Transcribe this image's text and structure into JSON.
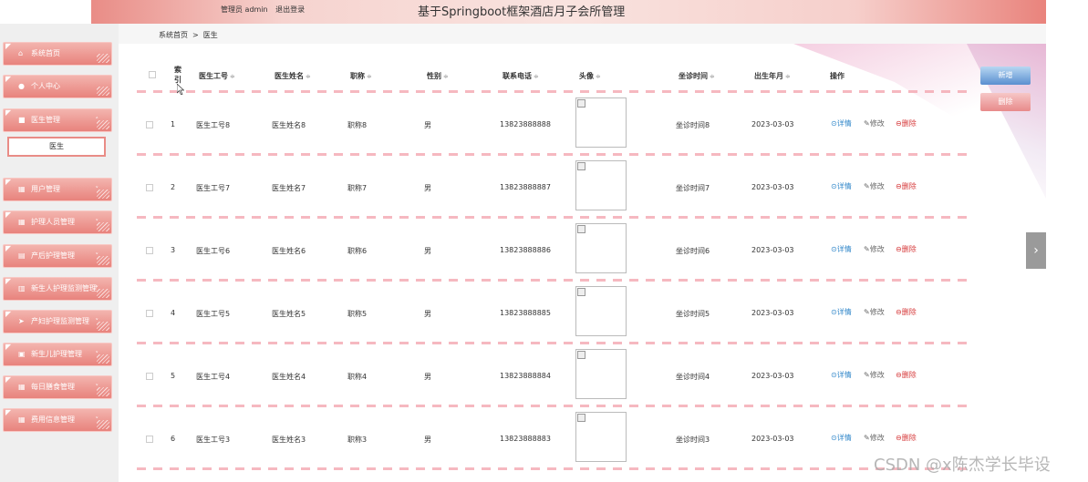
{
  "header": {
    "user_label": "管理员 admin",
    "logout_label": "退出登录",
    "title": "基于Springboot框架酒店月子会所管理"
  },
  "breadcrumb": {
    "home": "系统首页",
    "separator": ">",
    "current": "医生"
  },
  "sidebar": {
    "items": [
      {
        "label": "系统首页",
        "icon": "home-icon",
        "glyph": "⌂"
      },
      {
        "label": "个人中心",
        "icon": "user-icon",
        "glyph": "●"
      },
      {
        "label": "医生管理",
        "icon": "folder-icon",
        "glyph": "■"
      },
      {
        "label": "用户管理",
        "icon": "grid-icon",
        "glyph": "▦"
      },
      {
        "label": "护理人员管理",
        "icon": "grid-icon",
        "glyph": "▦"
      },
      {
        "label": "产后护理管理",
        "icon": "list-icon",
        "glyph": "▤"
      },
      {
        "label": "新生人护理监测管理",
        "icon": "bar-chart-icon",
        "glyph": "▥"
      },
      {
        "label": "产妇护理监测管理",
        "icon": "send-icon",
        "glyph": "➤"
      },
      {
        "label": "新生儿护理管理",
        "icon": "calendar-icon",
        "glyph": "▣"
      },
      {
        "label": "每日膳食管理",
        "icon": "grid-icon",
        "glyph": "▦"
      },
      {
        "label": "费用信息管理",
        "icon": "grid-icon",
        "glyph": "▦"
      }
    ],
    "submenu": {
      "label": "医生"
    }
  },
  "table": {
    "columns": {
      "index_line1": "索",
      "index_line2": "引",
      "doctor_id": "医生工号",
      "doctor_name": "医生姓名",
      "title": "职称",
      "gender": "性别",
      "phone": "联系电话",
      "avatar": "头像",
      "clinic_time": "坐诊时间",
      "birth": "出生年月",
      "actions": "操作"
    },
    "sort_glyph": "≑",
    "rows": [
      {
        "index": "1",
        "doctor_id": "医生工号8",
        "doctor_name": "医生姓名8",
        "title": "职称8",
        "gender": "男",
        "phone": "13823888888",
        "clinic_time": "坐诊时间8",
        "birth": "2023-03-03"
      },
      {
        "index": "2",
        "doctor_id": "医生工号7",
        "doctor_name": "医生姓名7",
        "title": "职称7",
        "gender": "男",
        "phone": "13823888887",
        "clinic_time": "坐诊时间7",
        "birth": "2023-03-03"
      },
      {
        "index": "3",
        "doctor_id": "医生工号6",
        "doctor_name": "医生姓名6",
        "title": "职称6",
        "gender": "男",
        "phone": "13823888886",
        "clinic_time": "坐诊时间6",
        "birth": "2023-03-03"
      },
      {
        "index": "4",
        "doctor_id": "医生工号5",
        "doctor_name": "医生姓名5",
        "title": "职称5",
        "gender": "男",
        "phone": "13823888885",
        "clinic_time": "坐诊时间5",
        "birth": "2023-03-03"
      },
      {
        "index": "5",
        "doctor_id": "医生工号4",
        "doctor_name": "医生姓名4",
        "title": "职称4",
        "gender": "男",
        "phone": "13823888884",
        "clinic_time": "坐诊时间4",
        "birth": "2023-03-03"
      },
      {
        "index": "6",
        "doctor_id": "医生工号3",
        "doctor_name": "医生姓名3",
        "title": "职称3",
        "gender": "男",
        "phone": "13823888883",
        "clinic_time": "坐诊时间3",
        "birth": "2023-03-03"
      }
    ],
    "actions": {
      "detail": "⊙详情",
      "edit": "✎修改",
      "delete": "⊖删除"
    }
  },
  "buttons": {
    "add": "新增",
    "delete": "删除"
  },
  "side_toggle": "›",
  "watermark": "CSDN @x陈杰学长毕设",
  "colors": {
    "accent": "#e98c86",
    "link": "#2f86c9",
    "danger": "#d6393a"
  }
}
